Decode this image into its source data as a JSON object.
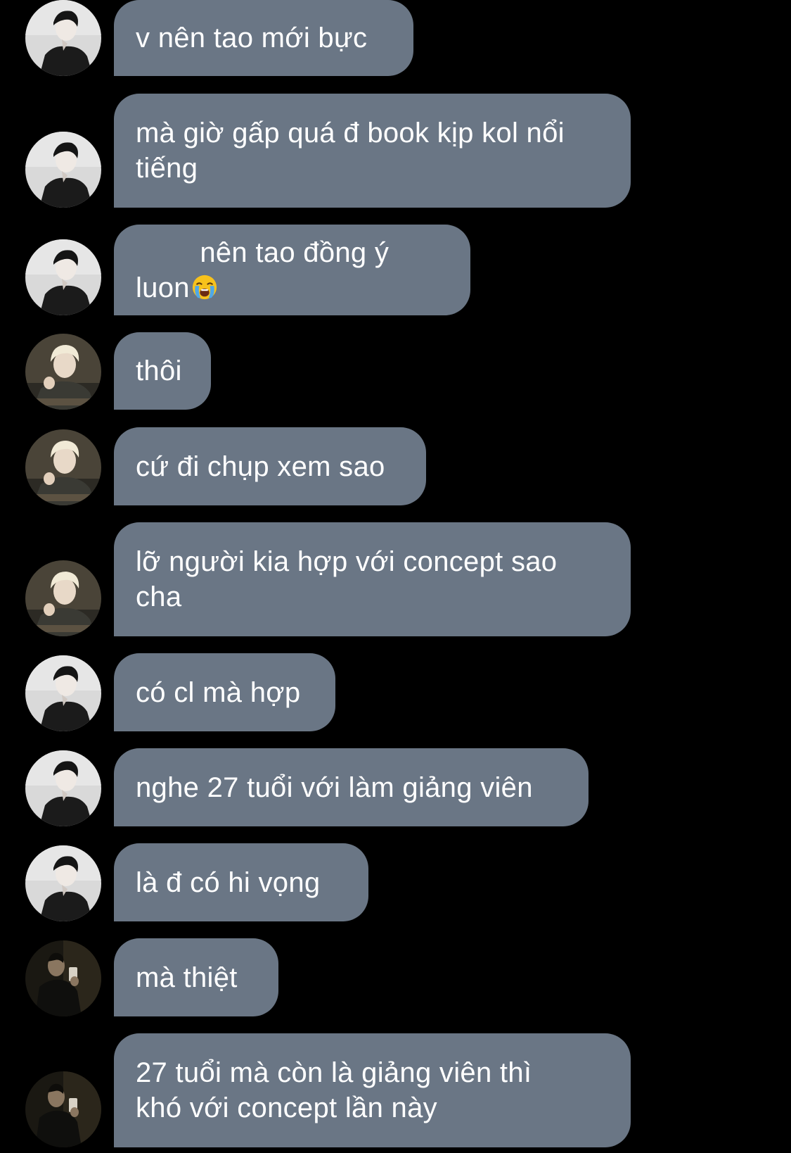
{
  "theme": {
    "background": "#000000",
    "bubble_color": "#6a7685",
    "text_color": "#ffffff"
  },
  "avatars": {
    "a": "avatar-dark-hair-portrait",
    "b": "avatar-blonde-portrait",
    "c": "avatar-mirror-selfie"
  },
  "messages": [
    {
      "text": "v nên tao mới bực",
      "avatar": "a"
    },
    {
      "text": "mà giờ gấp quá đ book kịp kol nổi\ntiếng",
      "avatar": "a"
    },
    {
      "text": "nên tao đồng ý luon",
      "emoji": "loudly-crying-face",
      "avatar": "a"
    },
    {
      "text": "thôi",
      "avatar": "b"
    },
    {
      "text": "cứ đi chụp xem sao",
      "avatar": "b"
    },
    {
      "text": "lỡ người kia hợp với concept sao\ncha",
      "avatar": "b"
    },
    {
      "text": "có cl mà hợp",
      "avatar": "a"
    },
    {
      "text": "nghe 27 tuổi với làm giảng viên",
      "avatar": "a"
    },
    {
      "text": "là đ có hi vọng",
      "avatar": "a"
    },
    {
      "text": "mà thiệt",
      "avatar": "c"
    },
    {
      "text": "27 tuổi mà còn là giảng viên thì\nkhó với concept lần này",
      "avatar": "c"
    }
  ]
}
